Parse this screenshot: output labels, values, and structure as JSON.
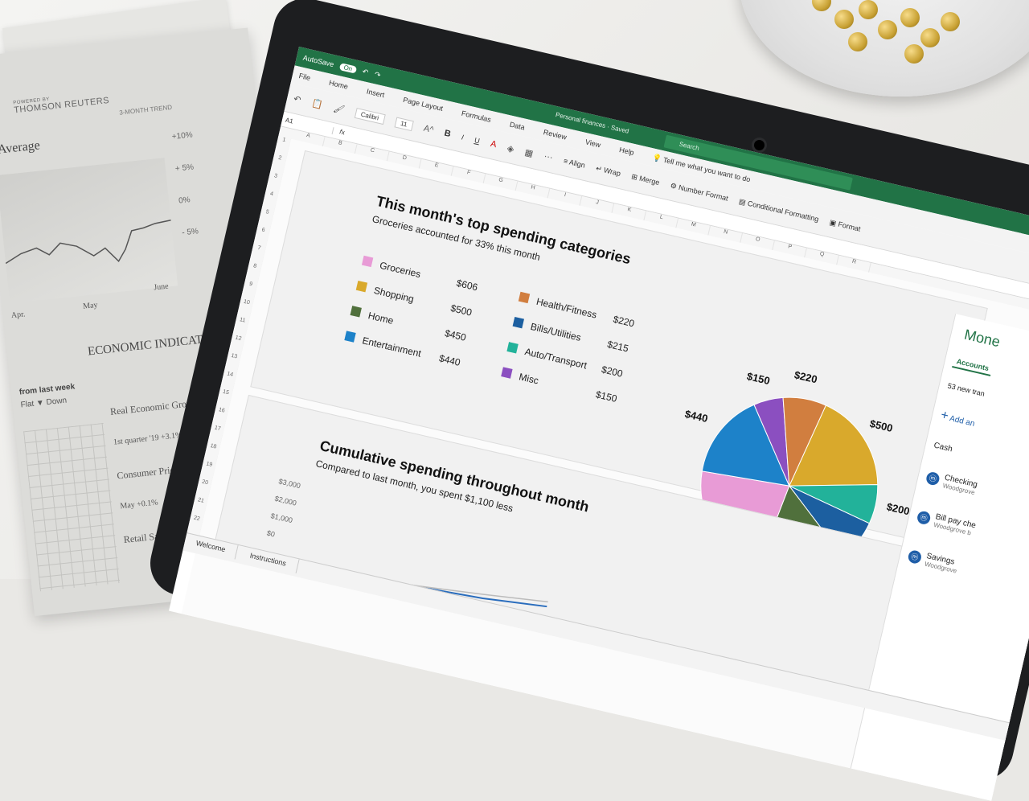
{
  "newspaper": {
    "powered_by": "POWERED BY",
    "brand": "THOMSON REUTERS",
    "index_title": "al Average",
    "trend_label": "3-MONTH TREND",
    "ticks": [
      "+10%",
      "+ 5%",
      "0%",
      "- 5%"
    ],
    "months": [
      "Apr.",
      "May",
      "June"
    ],
    "section": "ECONOMIC INDICATORS",
    "change_label": "from last week",
    "legend": "Flat  ▼ Down",
    "items": [
      {
        "title": "Real Economic Growth",
        "line": "1st quarter '19 +3.1%"
      },
      {
        "title": "Consumer Price I",
        "line": "May +0.1%"
      },
      {
        "title": "Retail Sa",
        "line": ""
      }
    ]
  },
  "excel": {
    "autosave": "AutoSave",
    "autosave_state": "On",
    "doc_title": "Personal finances · Saved",
    "search_placeholder": "Search",
    "menu": [
      "File",
      "Home",
      "Insert",
      "Page Layout",
      "Formulas",
      "Data",
      "Review",
      "View",
      "Help"
    ],
    "tell_me": "Tell me what you want to do",
    "font_name": "Calibri",
    "font_size": "11",
    "ribbon": {
      "bold": "B",
      "italic": "I",
      "underline": "U",
      "align": "Align",
      "wrap": "Wrap",
      "merge": "Merge",
      "number_format": "Number Format",
      "conditional": "Conditional Formatting",
      "format": "Format"
    },
    "name_box": "A1",
    "columns": [
      "A",
      "B",
      "C",
      "D",
      "E",
      "F",
      "G",
      "H",
      "I",
      "J",
      "K",
      "L",
      "M",
      "N",
      "O",
      "P",
      "Q",
      "R"
    ],
    "rows": [
      "1",
      "2",
      "3",
      "4",
      "5",
      "6",
      "7",
      "8",
      "9",
      "10",
      "11",
      "12",
      "13",
      "14",
      "15",
      "16",
      "17",
      "18",
      "19",
      "20",
      "21",
      "22"
    ],
    "sheet_tabs": [
      "Welcome",
      "Instructions"
    ]
  },
  "card1": {
    "title": "This month's top spending categories",
    "subtitle": "Groceries accounted for 33% this month"
  },
  "card2": {
    "title": "Cumulative spending throughout month",
    "subtitle": "Compared to last month, you spent $1,100 less",
    "y_ticks": [
      "$3,000",
      "$2,000",
      "$1,000",
      "$0"
    ]
  },
  "colors": {
    "groceries": "#e89bd6",
    "shopping": "#d9a92c",
    "home": "#50703c",
    "entertainment": "#1d82c9",
    "health": "#d17e3f",
    "bills": "#1c5fa0",
    "auto": "#22b29a",
    "misc": "#8b4fc0",
    "excel_green": "#217346"
  },
  "chart_data": {
    "type": "pie",
    "title": "This month's top spending categories",
    "categories": [
      "Groceries",
      "Shopping",
      "Home",
      "Entertainment",
      "Health/Fitness",
      "Bills/Utilities",
      "Auto/Transport",
      "Misc"
    ],
    "values": [
      606,
      500,
      450,
      440,
      220,
      215,
      200,
      150
    ],
    "labels": [
      "$606",
      "$500",
      "$450",
      "$440",
      "$220",
      "$215",
      "$200",
      "$150"
    ]
  },
  "side_pane": {
    "title": "Mone",
    "tab": "Accounts",
    "summary": "53 new tran",
    "add": "Add an",
    "section": "Cash",
    "accounts": [
      {
        "name": "Checking",
        "bank": "Woodgrove"
      },
      {
        "name": "Bill pay che",
        "bank": "Woodgrove b"
      },
      {
        "name": "Savings",
        "bank": "Woodgrove"
      }
    ]
  }
}
